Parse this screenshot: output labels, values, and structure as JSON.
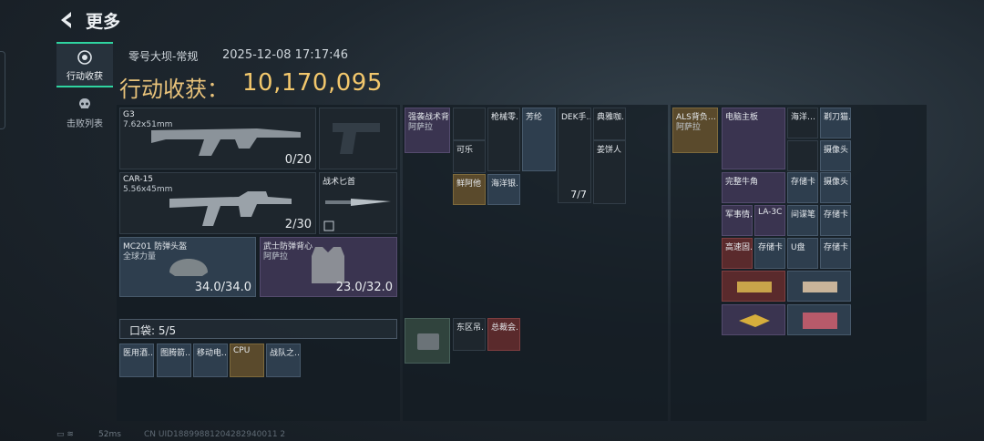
{
  "header": {
    "back_label": "更多",
    "map_name": "零号大坝-常规",
    "datetime": "2025-12-08 17:17:46",
    "harvest_label": "行动收获：",
    "harvest_value": "10,170,095"
  },
  "tabs": [
    {
      "label": "行动收获",
      "icon": "target-icon"
    },
    {
      "label": "击败列表",
      "icon": "skull-icon"
    }
  ],
  "loadout": {
    "primary": {
      "name": "G3",
      "ammo_type": "7.62x51mm",
      "ammo": "0/20"
    },
    "secondary": {
      "name": "CAR-15",
      "ammo_type": "5.56x45mm",
      "ammo": "2/30"
    },
    "melee": {
      "name": "战术匕首"
    },
    "helmet": {
      "name": "MC201 防弹头盔",
      "sub": "全球力量",
      "durability": "34.0/34.0"
    },
    "armor": {
      "name": "武士防弹背心",
      "sub": "阿萨拉",
      "durability": "23.0/32.0"
    }
  },
  "pocket": {
    "label": "口袋: 5/5",
    "items": [
      "医用酒…",
      "图腾箭…",
      "移动电…",
      "CPU",
      "战队之…"
    ]
  },
  "rig": {
    "name": "强袭战术背…",
    "sub": "阿萨拉",
    "items": [
      "",
      "可乐",
      "枪械零…",
      "芳纶",
      "DEK手…",
      "典雅咖…",
      "姜饼人",
      "鲜阿他",
      "海洋银…"
    ],
    "dek_count": "7/7"
  },
  "rig_extra": [
    "东区吊…",
    "总裁会…"
  ],
  "backpack": {
    "name": "ALS背负…",
    "sub": "阿萨拉",
    "items": [
      "电脑主板",
      "海洋…",
      "剃刀猫…",
      "摄像头",
      "完整牛角",
      "存储卡",
      "摄像头",
      "军事情…",
      "LA-3C",
      "间谍笔",
      "存储卡",
      "高速固…",
      "存储卡",
      "U盘",
      "存储卡",
      "",
      "",
      "",
      ""
    ]
  },
  "status": {
    "ping": "52ms",
    "uid": "CN UID18899881204282940011 2"
  },
  "colors": {
    "accent_green": "#2fd4a0",
    "harvest_gold": "#f2c76c"
  }
}
